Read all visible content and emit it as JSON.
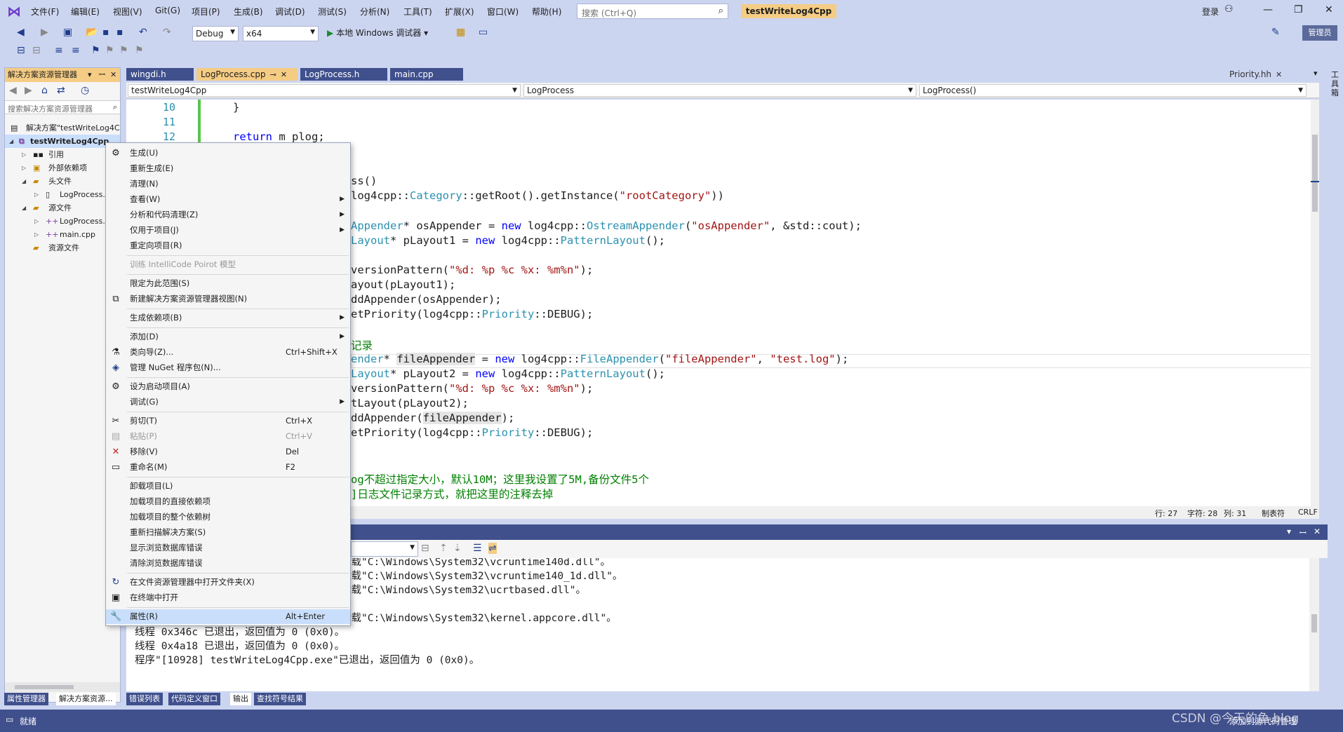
{
  "menu": {
    "items": [
      "文件(F)",
      "编辑(E)",
      "视图(V)",
      "Git(G)",
      "项目(P)",
      "生成(B)",
      "调试(D)",
      "测试(S)",
      "分析(N)",
      "工具(T)",
      "扩展(X)",
      "窗口(W)",
      "帮助(H)"
    ],
    "search_placeholder": "搜索 (Ctrl+Q)",
    "solution_title": "testWriteLog4Cpp",
    "login": "登录",
    "admin": "管理员"
  },
  "toolbar": {
    "config": "Debug",
    "platform": "x64",
    "run_label": "本地 Windows 调试器"
  },
  "solution_explorer": {
    "header": "解决方案资源管理器",
    "search_placeholder": "搜索解决方案资源管理器",
    "tree": [
      {
        "label": "解决方案\"testWriteLog4Cpp\"",
        "icon": "solution-icon"
      },
      {
        "label": "testWriteLog4Cpp",
        "icon": "project-icon"
      },
      {
        "label": "引用",
        "icon": "reference-icon"
      },
      {
        "label": "外部依赖项",
        "icon": "external-deps-icon"
      },
      {
        "label": "头文件",
        "icon": "folder-icon"
      },
      {
        "label": "LogProcess.h",
        "icon": "header-file-icon"
      },
      {
        "label": "源文件",
        "icon": "folder-icon"
      },
      {
        "label": "LogProcess.cpp",
        "icon": "cpp-file-icon"
      },
      {
        "label": "main.cpp",
        "icon": "cpp-file-icon"
      },
      {
        "label": "资源文件",
        "icon": "folder-icon"
      }
    ]
  },
  "bottom_left_tabs": [
    "属性管理器",
    "解决方案资源..."
  ],
  "doc_tabs": [
    "wingdi.h",
    "LogProcess.cpp",
    "LogProcess.h",
    "main.cpp"
  ],
  "doc_tab_right": "Priority.hh",
  "nav": {
    "project": "testWriteLog4Cpp",
    "scope": "LogProcess",
    "member": "LogProcess()"
  },
  "editor": {
    "line_numbers": [
      "10",
      "11",
      "12"
    ],
    "lines": {
      "l10": "}",
      "l12a": "return",
      "l12b": " m_plog;",
      "c1": "ss()",
      "c2a": "log4cpp::",
      "c2b": "Category",
      "c2c": "::getRoot().getInstance(",
      "c2d": "\"rootCategory\"",
      "c2e": "))",
      "c3a": "Appender",
      "c3b": "* osAppender = ",
      "c3c": "new",
      "c3d": " log4cpp::",
      "c3e": "OstreamAppender",
      "c3f": "(",
      "c3g": "\"osAppender\"",
      "c3h": ", &std::cout);",
      "c4a": "Layout",
      "c4b": "* pLayout1 = ",
      "c4c": "new",
      "c4d": " log4cpp::",
      "c4e": "PatternLayout",
      "c4f": "();",
      "c5a": "versionPattern(",
      "c5b": "\"%d: %p %c %x: %m%n\"",
      "c5c": ");",
      "c6": "ayout(pLayout1);",
      "c7": "ddAppender(osAppender);",
      "c8a": "etPriority(log4cpp::",
      "c8b": "Priority",
      "c8c": "::DEBUG);",
      "c9": "记录",
      "c10a": "ender",
      "c10b": "* ",
      "c10c": "fileAppender",
      "c10d": " = ",
      "c10e": "new",
      "c10f": " log4cpp::",
      "c10g": "FileAppender",
      "c10h": "(",
      "c10i": "\"fileAppender\"",
      "c10j": ", ",
      "c10k": "\"test.log\"",
      "c10l": ");",
      "c11a": "Layout",
      "c11b": "* pLayout2 = ",
      "c11c": "new",
      "c11d": " log4cpp::",
      "c11e": "PatternLayout",
      "c11f": "();",
      "c12a": "versionPattern(",
      "c12b": "\"%d: %p %c %x: %m%n\"",
      "c12c": ");",
      "c13": "tLayout(pLayout2);",
      "c14a": "ddAppender(",
      "c14b": "fileAppender",
      "c14c": ");",
      "c15a": "etPriority(log4cpp::",
      "c15b": "Priority",
      "c15c": "::DEBUG);",
      "c16": "og不超过指定大小，默认10M；这里我设置了5M,备份文件5个",
      "c17": "]日志文件记录方式，就把这里的注释去掉"
    }
  },
  "status_row": {
    "line": "行: 27",
    "char": "字符: 28",
    "col": "列: 31",
    "tab": "制表符",
    "eol": "CRLF"
  },
  "output": {
    "lines": [
      "加载\"C:\\Windows\\System32\\vcruntime140d.dll\"。",
      "加载\"C:\\Windows\\System32\\vcruntime140_1d.dll\"。",
      "加载\"C:\\Windows\\System32\\ucrtbased.dll\"。",
      "",
      "加载\"C:\\Windows\\System32\\kernel.appcore.dll\"。",
      "线程 0x346c 已退出，返回值为 0 (0x0)。",
      "线程 0x4a18 已退出，返回值为 0 (0x0)。",
      "程序\"[10928] testWriteLog4Cpp.exe\"已退出，返回值为 0 (0x0)。"
    ]
  },
  "output_tabs": [
    "错误列表",
    "代码定义窗口",
    "输出",
    "查找符号结果"
  ],
  "right_strip": "工具箱",
  "statusbar": {
    "ready": "就绪",
    "add_source": "添加到源代码管理"
  },
  "watermark": "CSDN @今天的鱼.blog",
  "context_menu": {
    "items": [
      {
        "label": "生成(U)",
        "icon": "build-icon"
      },
      {
        "label": "重新生成(E)"
      },
      {
        "label": "清理(N)"
      },
      {
        "label": "查看(W)",
        "sub": true
      },
      {
        "label": "分析和代码清理(Z)",
        "sub": true
      },
      {
        "label": "仅用于项目(J)",
        "sub": true
      },
      {
        "label": "重定向项目(R)"
      },
      {
        "label": "训练 IntelliCode Poirot 模型",
        "disabled": true
      },
      {
        "label": "限定为此范围(S)"
      },
      {
        "label": "新建解决方案资源管理器视图(N)",
        "icon": "new-view-icon"
      },
      {
        "label": "生成依赖项(B)",
        "sub": true
      },
      {
        "label": "添加(D)",
        "sub": true
      },
      {
        "label": "类向导(Z)...",
        "shortcut": "Ctrl+Shift+X",
        "icon": "class-wizard-icon"
      },
      {
        "label": "管理 NuGet 程序包(N)...",
        "icon": "nuget-icon"
      },
      {
        "label": "设为启动项目(A)",
        "icon": "gear-icon"
      },
      {
        "label": "调试(G)",
        "sub": true
      },
      {
        "label": "剪切(T)",
        "shortcut": "Ctrl+X",
        "icon": "scissors-icon"
      },
      {
        "label": "粘贴(P)",
        "shortcut": "Ctrl+V",
        "disabled": true,
        "icon": "paste-icon"
      },
      {
        "label": "移除(V)",
        "shortcut": "Del",
        "icon": "remove-icon"
      },
      {
        "label": "重命名(M)",
        "shortcut": "F2",
        "icon": "rename-icon"
      },
      {
        "label": "卸载项目(L)"
      },
      {
        "label": "加载项目的直接依赖项"
      },
      {
        "label": "加载项目的整个依赖树"
      },
      {
        "label": "重新扫描解决方案(S)"
      },
      {
        "label": "显示浏览数据库错误"
      },
      {
        "label": "清除浏览数据库错误"
      },
      {
        "label": "在文件资源管理器中打开文件夹(X)",
        "icon": "open-folder-icon"
      },
      {
        "label": "在终端中打开",
        "icon": "terminal-icon"
      },
      {
        "label": "属性(R)",
        "shortcut": "Alt+Enter",
        "icon": "wrench-icon"
      }
    ]
  }
}
